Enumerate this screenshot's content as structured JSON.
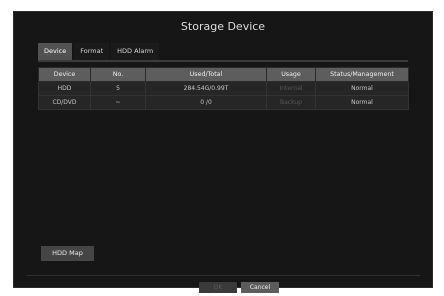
{
  "dialog": {
    "title": "Storage Device"
  },
  "tabs": [
    {
      "label": "Device"
    },
    {
      "label": "Format"
    },
    {
      "label": "HDD Alarm"
    }
  ],
  "table": {
    "headers": [
      "Device",
      "No.",
      "Used/Total",
      "Usage",
      "Status/Management"
    ],
    "rows": [
      [
        "HDD",
        "5",
        "284.54G/0.99T",
        "Internal",
        "Normal"
      ],
      [
        "CD/DVD",
        "~",
        "0 /0",
        "Backup",
        "Normal"
      ]
    ]
  },
  "buttons": {
    "hdd_map": "HDD Map",
    "ok": "OK",
    "cancel": "Cancel"
  }
}
